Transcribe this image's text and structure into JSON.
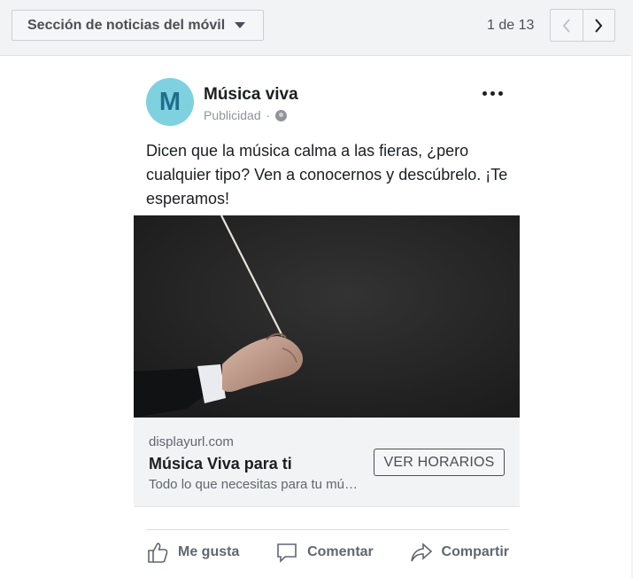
{
  "toolbar": {
    "placement_label": "Sección de noticias del móvil",
    "page_counter": "1 de 13"
  },
  "post": {
    "avatar_letter": "M",
    "page_name": "Música viva",
    "sponsored_label": "Publicidad",
    "separator": "·",
    "text": "Dicen que la música calma a las fieras, ¿pero cualquier tipo? Ven a conocernos y descúbrelo. ¡Te esperamos!"
  },
  "link": {
    "display_url": "displayurl.com",
    "headline": "Música Viva para ti",
    "description": "Todo lo que necesitas para tu música",
    "cta": "VER HORARIOS"
  },
  "actions": {
    "like": "Me gusta",
    "comment": "Comentar",
    "share": "Compartir"
  },
  "colors": {
    "avatar_bg": "#7fd1e0",
    "avatar_letter": "#1f6f8b",
    "media_bg": "#242424"
  }
}
